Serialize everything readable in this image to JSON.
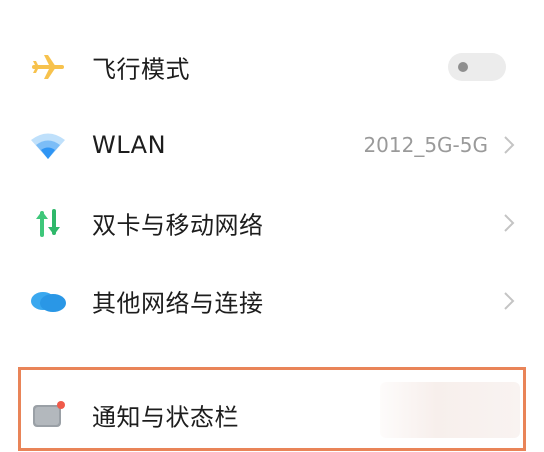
{
  "settings": {
    "items": [
      {
        "label": "飞行模式",
        "icon": "airplane-icon",
        "toggle_on": false
      },
      {
        "label": "WLAN",
        "icon": "wifi-icon",
        "value": "2012_5G-5G"
      },
      {
        "label": "双卡与移动网络",
        "icon": "dual-sim-data-icon"
      },
      {
        "label": "其他网络与连接",
        "icon": "cloud-connection-icon"
      },
      {
        "label": "通知与状态栏",
        "icon": "notification-icon"
      }
    ]
  },
  "colors": {
    "airplane": "#f7c24d",
    "wifi": "#2f95f4",
    "data_green": "#3ec77a",
    "cloud": "#3aa8ef",
    "highlight": "#e98458"
  }
}
